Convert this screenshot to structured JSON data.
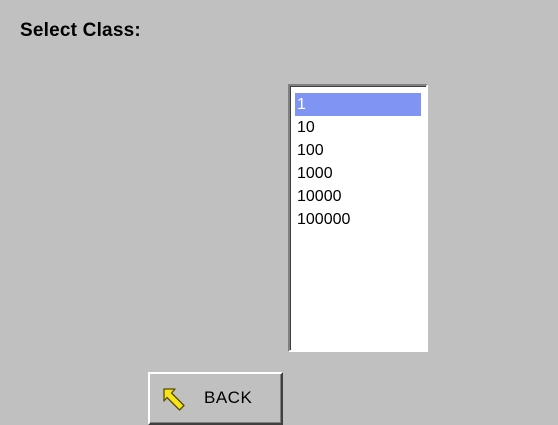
{
  "title": "Select Class:",
  "class_list": {
    "items": [
      "1",
      "10",
      "100",
      "1000",
      "10000",
      "100000"
    ],
    "selected": "1"
  },
  "back_button": {
    "label": "BACK",
    "icon": "yellow-arrow-back-icon"
  },
  "colors": {
    "background": "#c0c0c0",
    "selection": "#8094f3",
    "icon_fill": "#f5e61a"
  }
}
